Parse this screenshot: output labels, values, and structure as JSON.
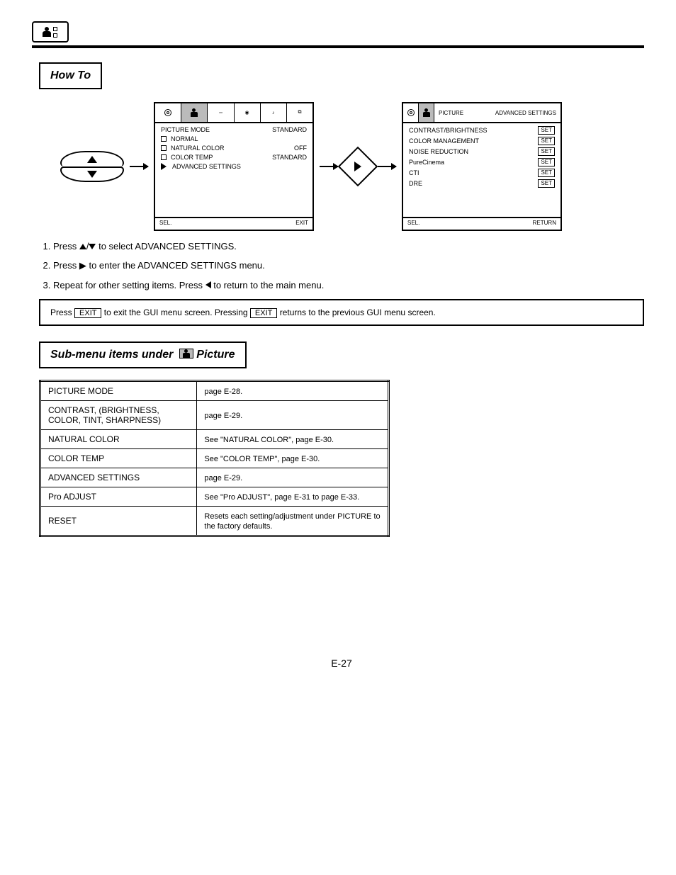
{
  "header": {
    "icon_name": "picture-menu-icon"
  },
  "howto": {
    "title": "How To",
    "screen1": {
      "tabs": [
        "",
        "",
        "",
        "",
        "",
        ""
      ],
      "items": [
        {
          "label": "PICTURE MODE",
          "val": "STANDARD"
        },
        {
          "label": "NORMAL",
          "val": ""
        },
        {
          "label": "NATURAL COLOR",
          "val": "OFF"
        },
        {
          "label": "COLOR TEMP",
          "val": "STANDARD"
        },
        {
          "label": "ADVANCED SETTINGS",
          "val": ""
        }
      ],
      "foot_left": "SEL.",
      "foot_right": "EXIT"
    },
    "screen2": {
      "title_left": "PICTURE",
      "title_right": "ADVANCED SETTINGS",
      "items": [
        {
          "label": "CONTRAST/BRIGHTNESS",
          "btn": "SET"
        },
        {
          "label": "COLOR MANAGEMENT",
          "btn": "SET"
        },
        {
          "label": "NOISE REDUCTION",
          "btn": "SET"
        },
        {
          "label": "PureCinema",
          "btn": "SET"
        },
        {
          "label": "CTI",
          "btn": "SET"
        },
        {
          "label": "DRE",
          "btn": "SET"
        }
      ],
      "foot_left": "SEL.",
      "foot_right": "RETURN"
    },
    "steps": [
      "Press ▲/▼ to select ADVANCED SETTINGS.",
      "Press ▶ to enter the ADVANCED SETTINGS menu.",
      "Repeat for other setting items. Press ◄ to return to the main menu."
    ],
    "note": "EXIT Press        to exit the GUI menu screen. Pressing   returns to the previous GUI menu screen.",
    "exit_label": "EXIT"
  },
  "submenu": {
    "title": "Sub-menu items under",
    "tail": "Picture",
    "rows": [
      {
        "l": "PICTURE MODE",
        "r": "page E-28."
      },
      {
        "l": "CONTRAST, (BRIGHTNESS, COLOR, TINT, SHARPNESS)",
        "r": "page E-29."
      },
      {
        "l": "NATURAL COLOR",
        "r": "See \"NATURAL COLOR\", page E-30."
      },
      {
        "l": "COLOR TEMP",
        "r": "See \"COLOR TEMP\", page E-30."
      },
      {
        "l": "ADVANCED SETTINGS",
        "r": "page E-29."
      },
      {
        "l": "Pro ADJUST",
        "r": "See \"Pro ADJUST\", page E-31 to page E-33."
      },
      {
        "l": "RESET",
        "r": "Resets each setting/adjustment under PICTURE to the factory defaults."
      }
    ]
  },
  "footer": "E-27"
}
